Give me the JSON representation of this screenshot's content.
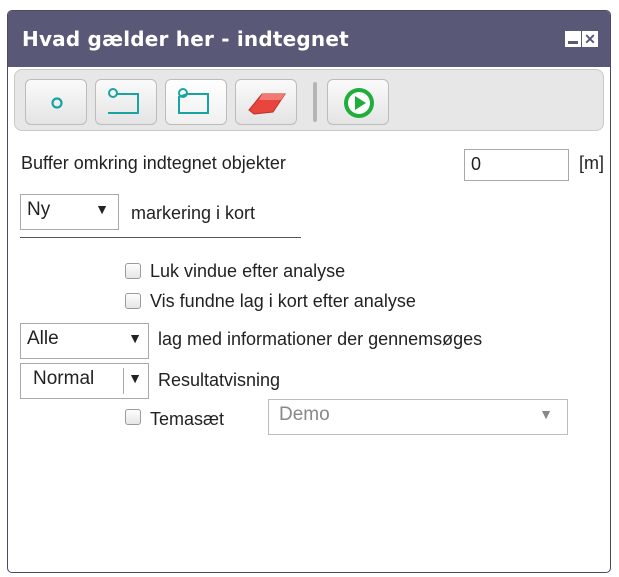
{
  "window": {
    "title": "Hvad gælder her - indtegnet",
    "minimize_icon": "minimize-icon",
    "close_icon": "close-icon",
    "close_glyph": "✕"
  },
  "toolbar": {
    "buttons": [
      {
        "name": "point",
        "icon": "point-draw-icon"
      },
      {
        "name": "line",
        "icon": "line-draw-icon"
      },
      {
        "name": "polygon",
        "icon": "polygon-draw-icon",
        "selected": true
      },
      {
        "name": "eraser",
        "icon": "eraser-icon"
      },
      {
        "name": "run",
        "icon": "play-icon"
      }
    ],
    "colors": {
      "draw": "#1aa3a3",
      "eraser": "#e8463c",
      "run": "#1fae3b"
    }
  },
  "buffer": {
    "label": "Buffer omkring indtegnet objekter",
    "value": "0",
    "unit": "[m]"
  },
  "marking": {
    "selected": "Ny",
    "label": "markering i kort"
  },
  "options": {
    "close_window": {
      "label": "Luk vindue efter analyse",
      "checked": false
    },
    "show_layers": {
      "label": "Vis fundne lag i kort efter analyse",
      "checked": false
    }
  },
  "layers": {
    "selected": "Alle",
    "label": "lag med informationer der gennemsøges"
  },
  "result": {
    "selected": "Normal",
    "label": "Resultatvisning"
  },
  "theme": {
    "label": "Temasæt",
    "checked": false,
    "selected": "Demo"
  },
  "arrow_glyph": "▼"
}
